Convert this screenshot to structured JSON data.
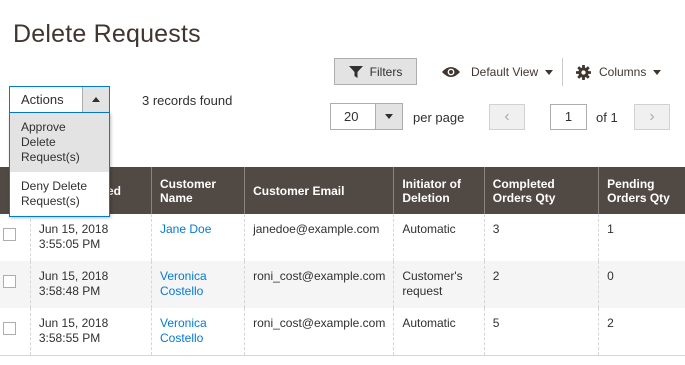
{
  "page": {
    "title": "Delete Requests"
  },
  "toolbar": {
    "filters_label": "Filters",
    "view_label": "Default View",
    "columns_label": "Columns"
  },
  "actions": {
    "label": "Actions",
    "items": [
      "Approve Delete Request(s)",
      "Deny Delete Request(s)"
    ]
  },
  "records_found": "3 records found",
  "pager": {
    "per_page_value": "20",
    "per_page_label": "per page",
    "prev": "‹",
    "next": "›",
    "current_page": "1",
    "of_label": "of 1"
  },
  "table": {
    "columns": [
      "",
      "Requested",
      "Customer Name",
      "Customer Email",
      "Initiator of Deletion",
      "Completed Orders Qty",
      "Pending Orders Qty"
    ],
    "header_visible_part": "ed",
    "rows": [
      {
        "date": "Jun 15, 2018 3:55:05 PM",
        "name": "Jane Doe",
        "email": "janedoe@example.com",
        "initiator": "Automatic",
        "completed": "3",
        "pending": "1"
      },
      {
        "date": "Jun 15, 2018 3:58:48 PM",
        "name": "Veronica Costello",
        "email": "roni_cost@example.com",
        "initiator": "Customer's request",
        "completed": "2",
        "pending": "0"
      },
      {
        "date": "Jun 15, 2018 3:58:55 PM",
        "name": "Veronica Costello",
        "email": "roni_cost@example.com",
        "initiator": "Automatic",
        "completed": "5",
        "pending": "2"
      }
    ]
  },
  "colors": {
    "header_bg": "#514943",
    "link": "#007bdb",
    "focus_border": "#007bdb"
  },
  "icons": [
    "funnel-icon",
    "eye-icon",
    "gear-icon"
  ]
}
